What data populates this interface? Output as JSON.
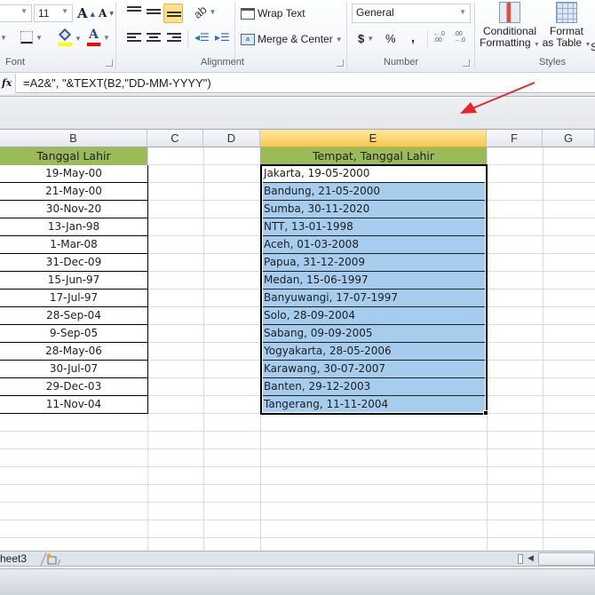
{
  "ribbon": {
    "font_size": "11",
    "wrap_text": "Wrap Text",
    "merge_center": "Merge & Center",
    "number_format": "General",
    "currency": "$",
    "percent": "%",
    "comma": ",",
    "increase_decimal": "←.0 .00",
    "decrease_decimal": ".00 →.0",
    "conditional_formatting_line1": "Conditional",
    "conditional_formatting_line2": "Formatting",
    "format_as_table_line1": "Format",
    "format_as_table_line2": "as Table",
    "cell_styles_partial": "S",
    "groups": {
      "font": "Font",
      "alignment": "Alignment",
      "number": "Number",
      "styles": "Styles"
    },
    "colors": {
      "highlight": "#ffff00",
      "font_color": "#ff0000",
      "active_align": "#fde08a"
    }
  },
  "formula_bar": {
    "fx_label": "fx",
    "formula": "=A2&\", \"&TEXT(B2,\"DD-MM-YYYY\")"
  },
  "columns": [
    "B",
    "C",
    "D",
    "E",
    "F",
    "G"
  ],
  "selected_column": "E",
  "table_b": {
    "header": "Tanggal Lahir",
    "values": [
      "19-May-00",
      "21-May-00",
      "30-Nov-20",
      "13-Jan-98",
      "1-Mar-08",
      "31-Dec-09",
      "15-Jun-97",
      "17-Jul-97",
      "28-Sep-04",
      "9-Sep-05",
      "28-May-06",
      "30-Jul-07",
      "29-Dec-03",
      "11-Nov-04"
    ]
  },
  "table_e": {
    "header": "Tempat, Tanggal Lahir",
    "values": [
      "Jakarta, 19-05-2000",
      "Bandung, 21-05-2000",
      "Sumba, 30-11-2020",
      "NTT, 13-01-1998",
      "Aceh, 01-03-2008",
      "Papua, 31-12-2009",
      "Medan, 15-06-1997",
      "Banyuwangi, 17-07-1997",
      "Solo, 28-09-2004",
      "Sabang, 09-09-2005",
      "Yogyakarta, 28-05-2006",
      "Karawang, 30-07-2007",
      "Banten, 29-12-2003",
      "Tangerang, 11-11-2004"
    ]
  },
  "colors": {
    "header_fill": "#9bbb59",
    "selection_fill": "#a6cdee",
    "arrow": "#e8242a"
  },
  "sheet_tabs": {
    "visible_tab": "heet3"
  }
}
